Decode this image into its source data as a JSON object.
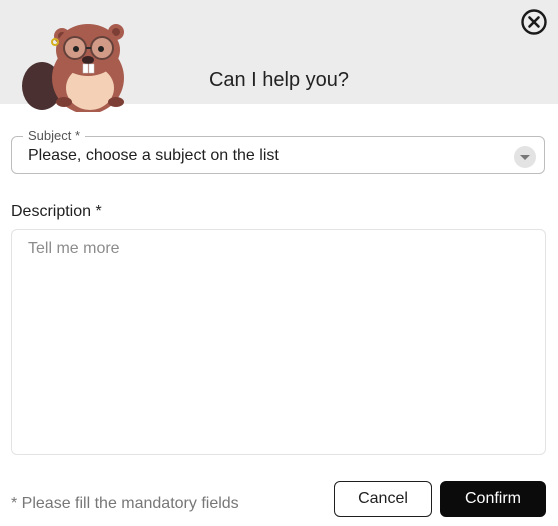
{
  "dialog": {
    "title": "Can I help you?",
    "mascot_icon": "beaver-mascot-icon",
    "close_icon": "close-circle-icon"
  },
  "form": {
    "subject": {
      "label": "Subject *",
      "value": "Please, choose a subject on the list"
    },
    "description": {
      "label": "Description *",
      "placeholder": "Tell me more",
      "value": ""
    },
    "mandatory_note": "* Please fill the mandatory fields"
  },
  "actions": {
    "cancel_label": "Cancel",
    "confirm_label": "Confirm"
  },
  "colors": {
    "header_bg": "#ececec",
    "confirm_bg": "#0b0b0b",
    "mascot_fur": "#a85c4e"
  }
}
